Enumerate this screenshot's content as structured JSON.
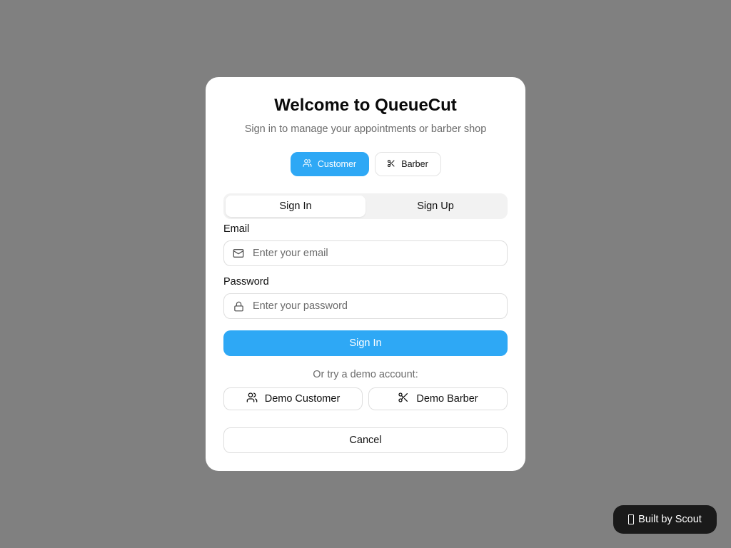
{
  "modal": {
    "title": "Welcome to QueueCut",
    "subtitle": "Sign in to manage your appointments or barber shop"
  },
  "roles": {
    "customer": {
      "label": "Customer",
      "icon": "users-icon",
      "active": true
    },
    "barber": {
      "label": "Barber",
      "icon": "scissors-icon",
      "active": false
    }
  },
  "tabs": {
    "sign_in": "Sign In",
    "sign_up": "Sign Up",
    "active": "sign_in"
  },
  "form": {
    "email_label": "Email",
    "email_placeholder": "Enter your email",
    "email_icon": "mail-icon",
    "password_label": "Password",
    "password_placeholder": "Enter your password",
    "password_icon": "lock-icon",
    "submit_label": "Sign In"
  },
  "demo": {
    "label": "Or try a demo account:",
    "customer_label": "Demo Customer",
    "barber_label": "Demo Barber"
  },
  "cancel_label": "Cancel",
  "badge": {
    "label": "Built by Scout"
  },
  "colors": {
    "accent": "#2ea8f5",
    "overlay": "#808080",
    "badge_bg": "#1a1a1a"
  }
}
